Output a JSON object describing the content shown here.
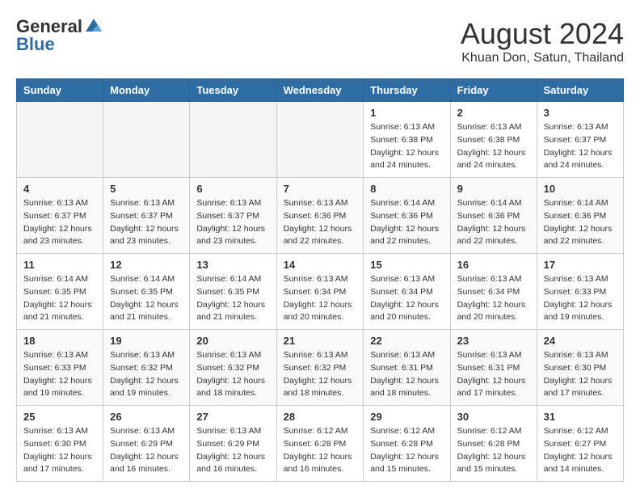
{
  "header": {
    "logo_general": "General",
    "logo_blue": "Blue",
    "month_title": "August 2024",
    "location": "Khuan Don, Satun, Thailand"
  },
  "weekdays": [
    "Sunday",
    "Monday",
    "Tuesday",
    "Wednesday",
    "Thursday",
    "Friday",
    "Saturday"
  ],
  "weeks": [
    [
      {
        "day": "",
        "info": ""
      },
      {
        "day": "",
        "info": ""
      },
      {
        "day": "",
        "info": ""
      },
      {
        "day": "",
        "info": ""
      },
      {
        "day": "1",
        "info": "Sunrise: 6:13 AM\nSunset: 6:38 PM\nDaylight: 12 hours\nand 24 minutes."
      },
      {
        "day": "2",
        "info": "Sunrise: 6:13 AM\nSunset: 6:38 PM\nDaylight: 12 hours\nand 24 minutes."
      },
      {
        "day": "3",
        "info": "Sunrise: 6:13 AM\nSunset: 6:37 PM\nDaylight: 12 hours\nand 24 minutes."
      }
    ],
    [
      {
        "day": "4",
        "info": "Sunrise: 6:13 AM\nSunset: 6:37 PM\nDaylight: 12 hours\nand 23 minutes."
      },
      {
        "day": "5",
        "info": "Sunrise: 6:13 AM\nSunset: 6:37 PM\nDaylight: 12 hours\nand 23 minutes."
      },
      {
        "day": "6",
        "info": "Sunrise: 6:13 AM\nSunset: 6:37 PM\nDaylight: 12 hours\nand 23 minutes."
      },
      {
        "day": "7",
        "info": "Sunrise: 6:13 AM\nSunset: 6:36 PM\nDaylight: 12 hours\nand 22 minutes."
      },
      {
        "day": "8",
        "info": "Sunrise: 6:14 AM\nSunset: 6:36 PM\nDaylight: 12 hours\nand 22 minutes."
      },
      {
        "day": "9",
        "info": "Sunrise: 6:14 AM\nSunset: 6:36 PM\nDaylight: 12 hours\nand 22 minutes."
      },
      {
        "day": "10",
        "info": "Sunrise: 6:14 AM\nSunset: 6:36 PM\nDaylight: 12 hours\nand 22 minutes."
      }
    ],
    [
      {
        "day": "11",
        "info": "Sunrise: 6:14 AM\nSunset: 6:35 PM\nDaylight: 12 hours\nand 21 minutes."
      },
      {
        "day": "12",
        "info": "Sunrise: 6:14 AM\nSunset: 6:35 PM\nDaylight: 12 hours\nand 21 minutes."
      },
      {
        "day": "13",
        "info": "Sunrise: 6:14 AM\nSunset: 6:35 PM\nDaylight: 12 hours\nand 21 minutes."
      },
      {
        "day": "14",
        "info": "Sunrise: 6:13 AM\nSunset: 6:34 PM\nDaylight: 12 hours\nand 20 minutes."
      },
      {
        "day": "15",
        "info": "Sunrise: 6:13 AM\nSunset: 6:34 PM\nDaylight: 12 hours\nand 20 minutes."
      },
      {
        "day": "16",
        "info": "Sunrise: 6:13 AM\nSunset: 6:34 PM\nDaylight: 12 hours\nand 20 minutes."
      },
      {
        "day": "17",
        "info": "Sunrise: 6:13 AM\nSunset: 6:33 PM\nDaylight: 12 hours\nand 19 minutes."
      }
    ],
    [
      {
        "day": "18",
        "info": "Sunrise: 6:13 AM\nSunset: 6:33 PM\nDaylight: 12 hours\nand 19 minutes."
      },
      {
        "day": "19",
        "info": "Sunrise: 6:13 AM\nSunset: 6:32 PM\nDaylight: 12 hours\nand 19 minutes."
      },
      {
        "day": "20",
        "info": "Sunrise: 6:13 AM\nSunset: 6:32 PM\nDaylight: 12 hours\nand 18 minutes."
      },
      {
        "day": "21",
        "info": "Sunrise: 6:13 AM\nSunset: 6:32 PM\nDaylight: 12 hours\nand 18 minutes."
      },
      {
        "day": "22",
        "info": "Sunrise: 6:13 AM\nSunset: 6:31 PM\nDaylight: 12 hours\nand 18 minutes."
      },
      {
        "day": "23",
        "info": "Sunrise: 6:13 AM\nSunset: 6:31 PM\nDaylight: 12 hours\nand 17 minutes."
      },
      {
        "day": "24",
        "info": "Sunrise: 6:13 AM\nSunset: 6:30 PM\nDaylight: 12 hours\nand 17 minutes."
      }
    ],
    [
      {
        "day": "25",
        "info": "Sunrise: 6:13 AM\nSunset: 6:30 PM\nDaylight: 12 hours\nand 17 minutes."
      },
      {
        "day": "26",
        "info": "Sunrise: 6:13 AM\nSunset: 6:29 PM\nDaylight: 12 hours\nand 16 minutes."
      },
      {
        "day": "27",
        "info": "Sunrise: 6:13 AM\nSunset: 6:29 PM\nDaylight: 12 hours\nand 16 minutes."
      },
      {
        "day": "28",
        "info": "Sunrise: 6:12 AM\nSunset: 6:28 PM\nDaylight: 12 hours\nand 16 minutes."
      },
      {
        "day": "29",
        "info": "Sunrise: 6:12 AM\nSunset: 6:28 PM\nDaylight: 12 hours\nand 15 minutes."
      },
      {
        "day": "30",
        "info": "Sunrise: 6:12 AM\nSunset: 6:28 PM\nDaylight: 12 hours\nand 15 minutes."
      },
      {
        "day": "31",
        "info": "Sunrise: 6:12 AM\nSunset: 6:27 PM\nDaylight: 12 hours\nand 14 minutes."
      }
    ]
  ]
}
